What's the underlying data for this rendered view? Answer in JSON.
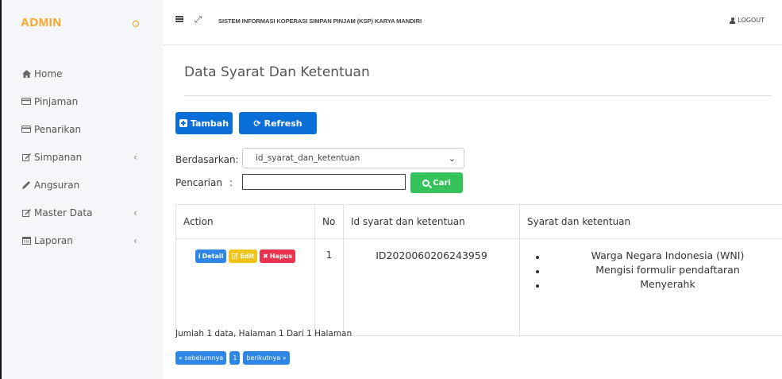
{
  "sidebar": {
    "brand": "ADMIN",
    "items": [
      {
        "label": "Home",
        "icon": "home-icon"
      },
      {
        "label": "Pinjaman",
        "icon": "credit-card-icon"
      },
      {
        "label": "Penarikan",
        "icon": "credit-card-icon"
      },
      {
        "label": "Simpanan",
        "icon": "edit-icon"
      },
      {
        "label": "Angsuran",
        "icon": "pencil-icon"
      },
      {
        "label": "Master Data",
        "icon": "edit-icon"
      },
      {
        "label": "Laporan",
        "icon": "calendar-icon"
      }
    ]
  },
  "header": {
    "system_title": "SISTEM INFORMASI KOPERASI SIMPAN PINJAM (KSP) KARYA MANDIRI",
    "logout_label": "LOGOUT"
  },
  "main": {
    "page_title": "Data Syarat Dan Ketentuan",
    "btn_tambah": "Tambah",
    "btn_refresh": "Refresh",
    "filter_label": "Berdasarkan:",
    "filter_selected": "id_syarat_dan_ketentuan",
    "search_label": "Pencarian",
    "search_colon": ":",
    "search_value": "",
    "btn_cari": "Cari"
  },
  "table": {
    "headers": [
      "Action",
      "No",
      "Id syarat dan ketentuan",
      "Syarat dan ketentuan"
    ],
    "rows": [
      {
        "actions": [
          "Detail",
          "Edit",
          "Hapus"
        ],
        "no": "1",
        "id": "ID2020060206243959",
        "syarat": [
          "Warga Negara Indonesia (WNI)",
          "Mengisi formulir pendaftaran",
          "Menyerahk"
        ]
      }
    ]
  },
  "footer": {
    "summary": "Jumlah 1 data, Halaman 1 Dari 1 Halaman",
    "pager_prev": "« sebelumnya",
    "pager_current": "1",
    "pager_next": "berikutnya »"
  },
  "colors": {
    "brand": "#f5a623",
    "primary": "#0b6fd9",
    "success": "#34c25a",
    "info": "#2f86e5",
    "warning": "#f0c419",
    "danger": "#e8344e"
  }
}
